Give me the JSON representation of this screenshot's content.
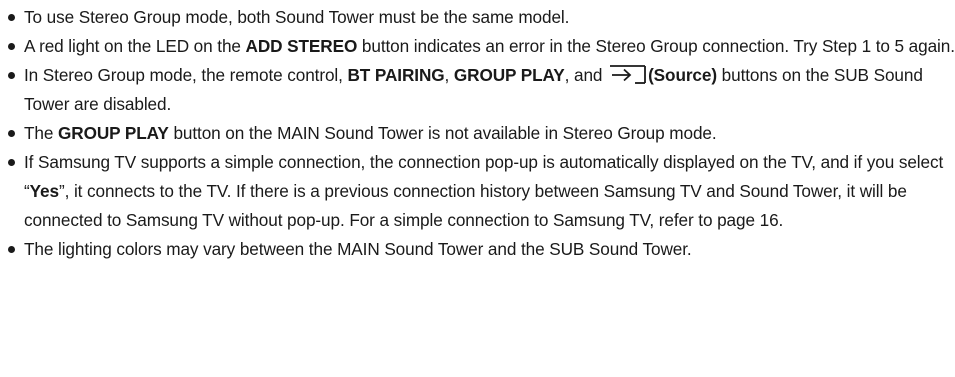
{
  "notes": {
    "item1": {
      "text": "To use Stereo Group mode, both Sound Tower must be the same model."
    },
    "item2": {
      "text_a": "A red light on the LED on the ",
      "bold_a": "ADD STEREO",
      "text_b": " button indicates an error in the Stereo Group connection. Try Step 1 to 5 again."
    },
    "item3": {
      "text_a": "In Stereo Group mode, the remote control, ",
      "bold_a": "BT PAIRING",
      "text_b": ", ",
      "bold_b": "GROUP PLAY",
      "text_c": ", and ",
      "icon": "source-icon",
      "bold_c": "(Source)",
      "text_d": " buttons on the SUB Sound Tower are disabled."
    },
    "item4": {
      "text_a": "The ",
      "bold_a": "GROUP PLAY",
      "text_b": " button on the MAIN Sound Tower is not available in Stereo Group mode."
    },
    "item5": {
      "text_a": "If Samsung TV supports a simple connection, the connection pop-up is automatically displayed on the TV, and if you select “",
      "bold_a": "Yes",
      "text_b": "”, it connects to the TV. If there is a previous connection history between Samsung TV and Sound Tower, it will be connected to Samsung TV without pop-up. For a simple connection to Samsung TV, refer to page 16."
    },
    "item6": {
      "text": "The lighting colors may vary between the MAIN Sound Tower and the SUB Sound Tower."
    }
  }
}
